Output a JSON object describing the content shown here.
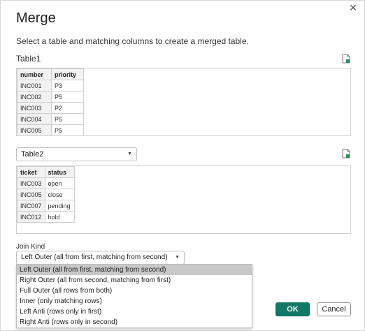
{
  "dialog": {
    "title": "Merge",
    "close_glyph": "✕",
    "description": "Select a table and matching columns to create a merged table."
  },
  "table1": {
    "label": "Table1",
    "icon": "file-preview-icon",
    "columns": [
      "number",
      "priority"
    ],
    "rows": [
      [
        "INC001",
        "P3"
      ],
      [
        "INC002",
        "P5"
      ],
      [
        "INC003",
        "P2"
      ],
      [
        "INC004",
        "P5"
      ],
      [
        "INC005",
        "P5"
      ]
    ]
  },
  "table2": {
    "selected": "Table2",
    "icon": "file-preview-icon",
    "columns": [
      "ticket",
      "status"
    ],
    "rows": [
      [
        "INC003",
        "open"
      ],
      [
        "INC005",
        "close"
      ],
      [
        "INC007",
        "pending"
      ],
      [
        "INC012",
        "hold"
      ]
    ]
  },
  "join": {
    "label": "Join Kind",
    "selected": "Left Outer (all from first, matching from second)",
    "options": [
      "Left Outer (all from first, matching from second)",
      "Right Outer (all from second, matching from first)",
      "Full Outer (all rows from both)",
      "Inner (only matching rows)",
      "Left Anti (rows only in first)",
      "Right Anti (rows only in second)"
    ]
  },
  "buttons": {
    "ok": "OK",
    "cancel": "Cancel"
  },
  "colors": {
    "accent": "#117865"
  }
}
